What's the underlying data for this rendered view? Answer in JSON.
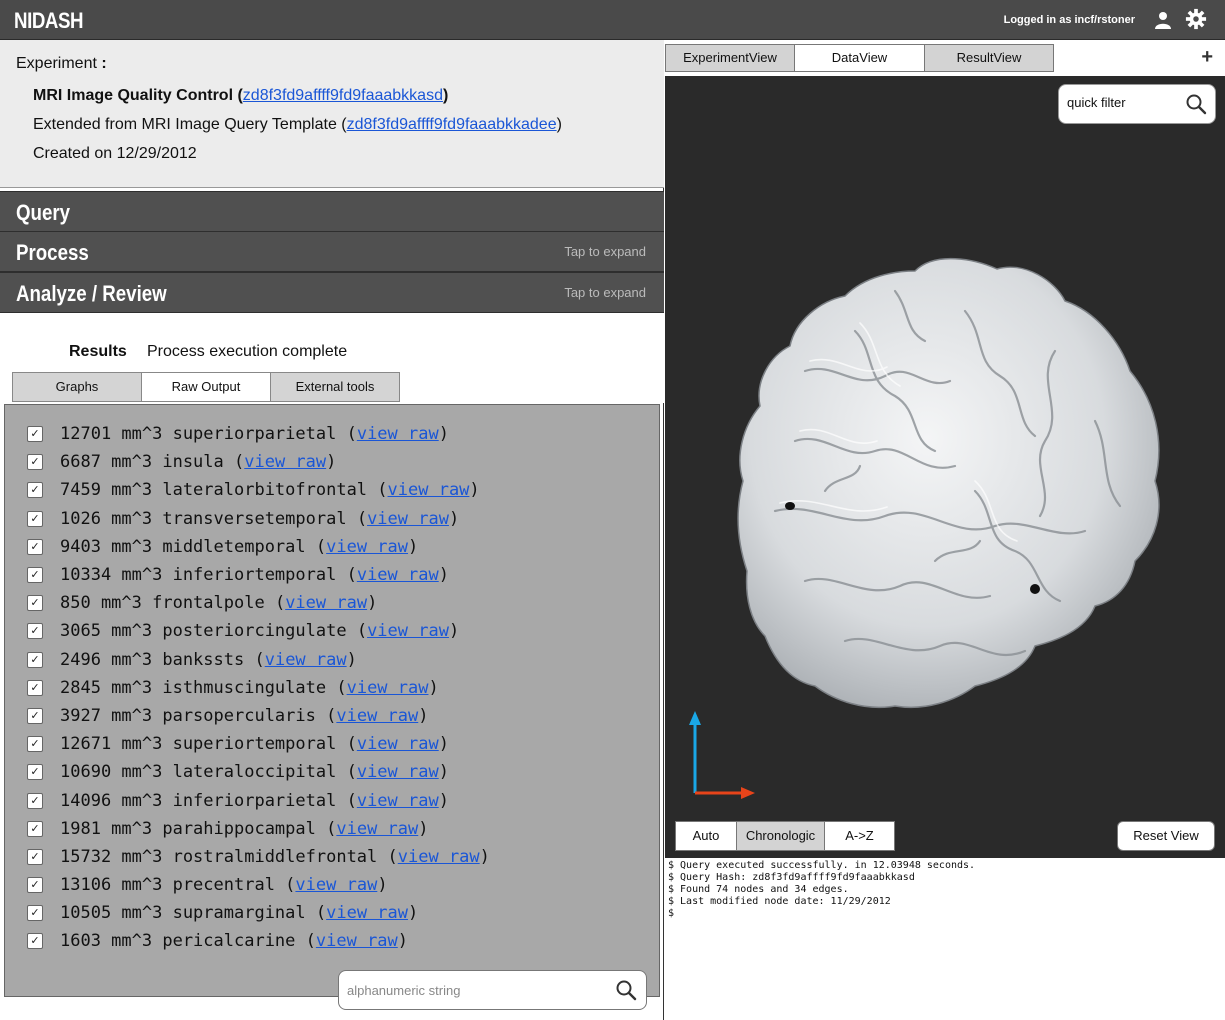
{
  "app": {
    "title": "NIDASH",
    "login_text": "Logged in as incf/rstoner"
  },
  "experiment": {
    "label": "Experiment",
    "name": "MRI Image Quality Control",
    "id": "zd8f3fd9affff9fd9faaabkkasd",
    "extended_prefix": "Extended from MRI Image Query Template",
    "template_id": "zd8f3fd9affff9fd9faaabkkadee",
    "created": "Created on 12/29/2012"
  },
  "sections": {
    "query": "Query",
    "process": "Process",
    "analyze": "Analyze / Review",
    "hint": "Tap to expand"
  },
  "results": {
    "label": "Results",
    "status": "Process execution complete",
    "tabs": [
      "Graphs",
      "Raw Output",
      "External tools"
    ],
    "active_tab": "Raw Output"
  },
  "raw_output": {
    "link_label": "view raw",
    "rows": [
      {
        "text": "12701 mm^3 superiorparietal"
      },
      {
        "text": "6687 mm^3 insula"
      },
      {
        "text": "7459 mm^3 lateralorbitofrontal"
      },
      {
        "text": "1026 mm^3 transversetemporal"
      },
      {
        "text": "9403 mm^3 middletemporal"
      },
      {
        "text": "10334 mm^3 inferiortemporal"
      },
      {
        "text": "850 mm^3 frontalpole"
      },
      {
        "text": "3065 mm^3 posteriorcingulate"
      },
      {
        "text": "2496 mm^3 bankssts"
      },
      {
        "text": "2845 mm^3 isthmuscingulate"
      },
      {
        "text": "3927 mm^3 parsopercularis"
      },
      {
        "text": "12671 mm^3 superiortemporal"
      },
      {
        "text": "10690 mm^3 lateraloccipital"
      },
      {
        "text": "14096 mm^3 inferiorparietal"
      },
      {
        "text": "1981 mm^3 parahippocampal"
      },
      {
        "text": "15732 mm^3 rostralmiddlefrontal"
      },
      {
        "text": "13106 mm^3 precentral"
      },
      {
        "text": "10505 mm^3 supramarginal"
      },
      {
        "text": "1603 mm^3 pericalcarine"
      }
    ]
  },
  "search": {
    "placeholder": "alphanumeric string"
  },
  "right_tabs": {
    "items": [
      "ExperimentView",
      "DataView",
      "ResultView"
    ],
    "active": "DataView",
    "add": "+"
  },
  "viewer": {
    "quick_filter": "quick filter",
    "axis_colors": {
      "y": "#1aa7e6",
      "x": "#e8441a"
    }
  },
  "controls": {
    "sort_modes": [
      "Auto",
      "Chronologic",
      "A->Z"
    ],
    "active_sort": "Chronologic",
    "reset": "Reset View"
  },
  "console": {
    "lines": [
      "$ Query executed successfully. in 12.03948 seconds.",
      "$ Query Hash: zd8f3fd9affff9fd9faaabkkasd",
      "$ Found 74 nodes and 34 edges.",
      "$ Last modified node date: 11/29/2012",
      "$"
    ]
  }
}
